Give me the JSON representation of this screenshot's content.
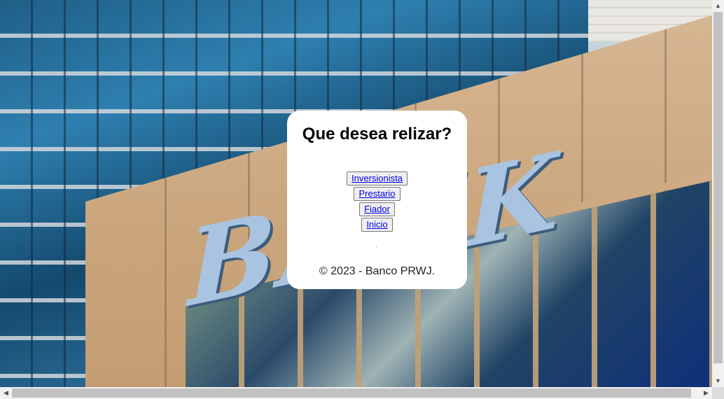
{
  "background": {
    "sign_text": "BANK"
  },
  "card": {
    "title": "Que desea relizar?",
    "buttons": [
      {
        "label": "Inversionista"
      },
      {
        "label": "Prestario"
      },
      {
        "label": "Fiador"
      },
      {
        "label": "Inicio"
      }
    ],
    "footer": "© 2023 - Banco PRWJ."
  },
  "scrollbars": {
    "up_icon": "▲",
    "down_icon": "▼",
    "left_icon": "◀",
    "right_icon": "▶"
  }
}
